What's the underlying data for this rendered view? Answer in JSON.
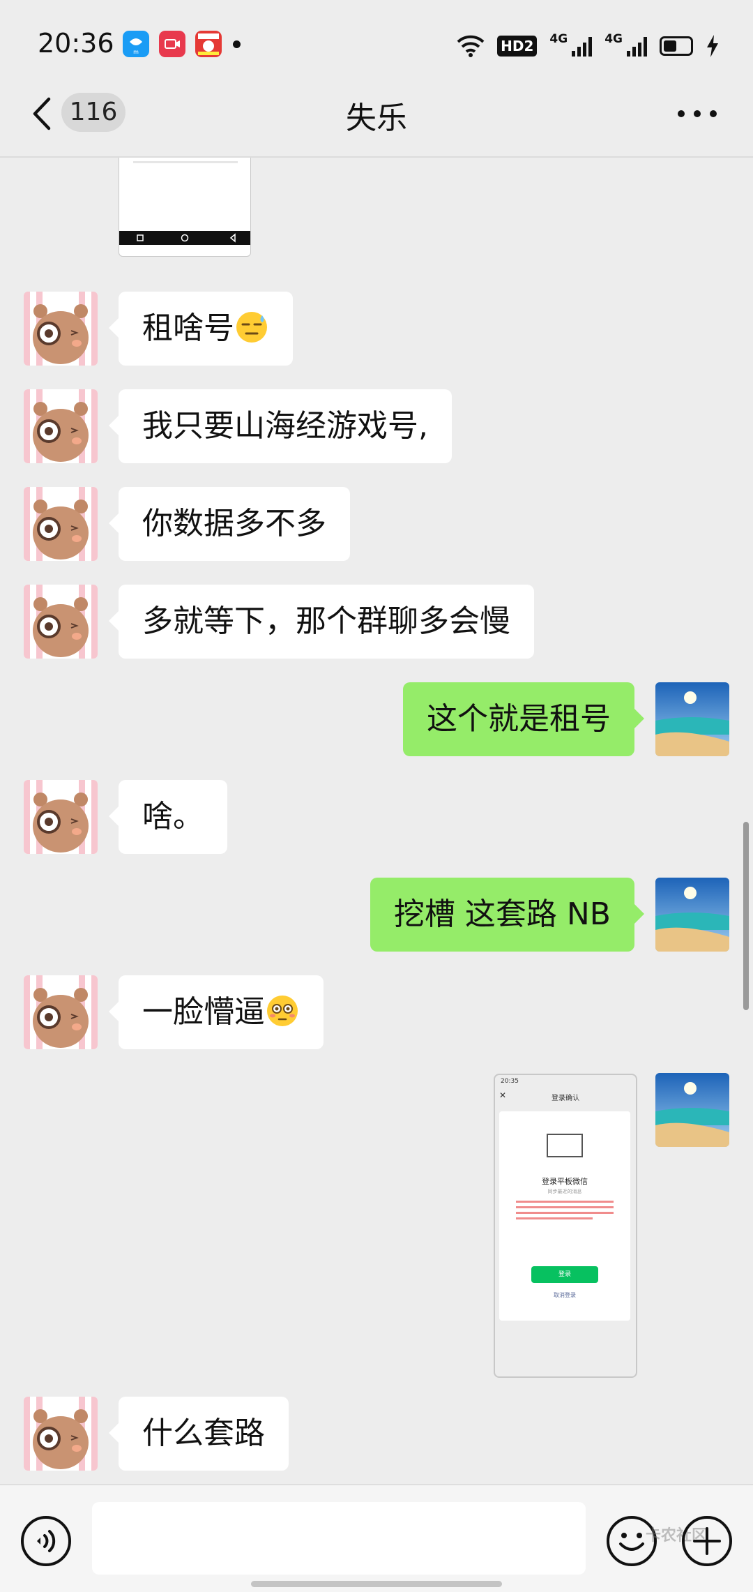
{
  "status_bar": {
    "time": "20:36",
    "app_icons": [
      {
        "name": "ele-app-icon",
        "color": "#1a9cf5"
      },
      {
        "name": "video-app-icon",
        "color": "#e8394d"
      },
      {
        "name": "promo-app-icon",
        "color": "#e53935"
      }
    ],
    "hd_label": "HD2",
    "network_labels": [
      "4G",
      "4G"
    ]
  },
  "header": {
    "unread_count": "116",
    "title": "失乐"
  },
  "messages": [
    {
      "side": "in",
      "text": "租啥号",
      "emoji": "sweat"
    },
    {
      "side": "in",
      "text": "我只要山海经游戏号,"
    },
    {
      "side": "in",
      "text": "你数据多不多"
    },
    {
      "side": "in",
      "text": "多就等下，那个群聊多会慢"
    },
    {
      "side": "out",
      "text": "这个就是租号"
    },
    {
      "side": "in",
      "text": "啥。"
    },
    {
      "side": "out",
      "text": "挖槽 这套路 NB"
    },
    {
      "side": "in",
      "text": "一脸懵逼",
      "emoji": "flushed"
    },
    {
      "side": "out",
      "type": "image"
    },
    {
      "side": "in",
      "text": "什么套路"
    }
  ],
  "shared_screenshot": {
    "time": "20:35",
    "title": "登录确认",
    "heading": "登录平板微信",
    "checkbox_label": "同步最近的消息",
    "login_button": "登录",
    "cancel_link": "取消登录"
  },
  "input_bar": {
    "placeholder": "",
    "watermark": "卡农社区"
  },
  "colors": {
    "background": "#ededed",
    "outgoing_bubble": "#95ec69",
    "incoming_bubble": "#ffffff",
    "login_button": "#07c160"
  }
}
